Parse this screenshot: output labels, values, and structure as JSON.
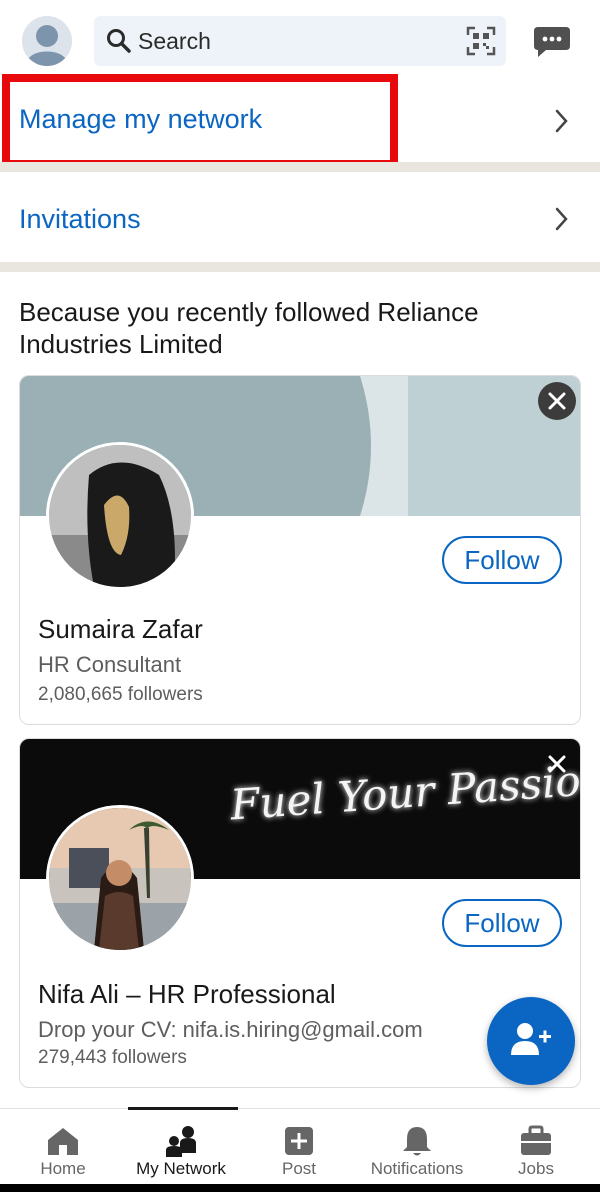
{
  "header": {
    "search_placeholder": "Search",
    "avatar_icon": "default-avatar-icon",
    "qr_icon": "qr-code-icon",
    "messaging_icon": "messaging-icon"
  },
  "rows": {
    "manage_network": "Manage my network",
    "invitations": "Invitations"
  },
  "section": {
    "title": "Because you recently followed Reliance Industries Limited"
  },
  "cards": [
    {
      "name": "Sumaira Zafar",
      "headline": "HR Consultant",
      "followers": "2,080,665 followers",
      "follow_label": "Follow"
    },
    {
      "name": "Nifa Ali – HR Professional",
      "headline": "Drop your CV: nifa.is.hiring@gmail.com",
      "followers": "279,443 followers",
      "follow_label": "Follow",
      "banner_text": "Fuel Your Passion"
    }
  ],
  "fab": {
    "icon": "add-person-icon"
  },
  "bottom_nav": {
    "items": [
      {
        "label": "Home",
        "icon": "home-icon"
      },
      {
        "label": "My Network",
        "icon": "network-icon",
        "active": true
      },
      {
        "label": "Post",
        "icon": "post-plus-icon"
      },
      {
        "label": "Notifications",
        "icon": "bell-icon"
      },
      {
        "label": "Jobs",
        "icon": "briefcase-icon"
      }
    ]
  },
  "colors": {
    "brand_blue": "#0a66c2",
    "highlight_red": "#e8090d",
    "divider": "#e9e5df"
  }
}
